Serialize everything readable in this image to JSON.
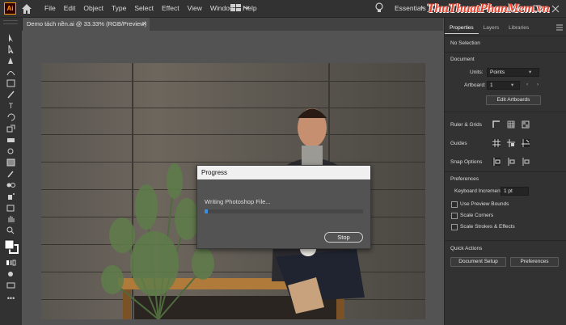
{
  "app": {
    "logo_text": "Ai"
  },
  "menu": {
    "items": [
      "File",
      "Edit",
      "Object",
      "Type",
      "Select",
      "Effect",
      "View",
      "Window",
      "Help"
    ]
  },
  "workspace": {
    "label": "Essentials"
  },
  "watermark": {
    "text": "ThuThuatPhanMem.vn"
  },
  "document": {
    "tab_label": "Demo tách nền.ai @ 33.33% (RGB/Preview)",
    "close_glyph": "✕"
  },
  "dialog": {
    "title": "Progress",
    "message": "Writing Photoshop File...",
    "progress_fraction": 0.02,
    "stop_label": "Stop",
    "progress_color": "#3b8de0"
  },
  "panel": {
    "tabs": [
      "Properties",
      "Layers",
      "Libraries"
    ],
    "selection_status": "No Selection",
    "document_heading": "Document",
    "units_label": "Units:",
    "units_value": "Points",
    "artboard_label": "Artboard:",
    "artboard_value": "1",
    "edit_artboards_label": "Edit Artboards",
    "ruler_grids_label": "Ruler & Grids",
    "guides_label": "Guides",
    "snap_label": "Snap Options",
    "preferences_heading": "Preferences",
    "keyboard_increment_label": "Keyboard Increment:",
    "keyboard_increment_value": "1 pt",
    "checkboxes": [
      "Use Preview Bounds",
      "Scale Corners",
      "Scale Strokes & Effects"
    ],
    "quick_actions_heading": "Quick Actions",
    "document_setup_label": "Document Setup",
    "preferences_button_label": "Preferences"
  },
  "colors": {
    "accent": "#3b8de0",
    "logo_bg": "#330000",
    "logo_fg": "#ff9a00",
    "watermark": "#e4432e"
  }
}
